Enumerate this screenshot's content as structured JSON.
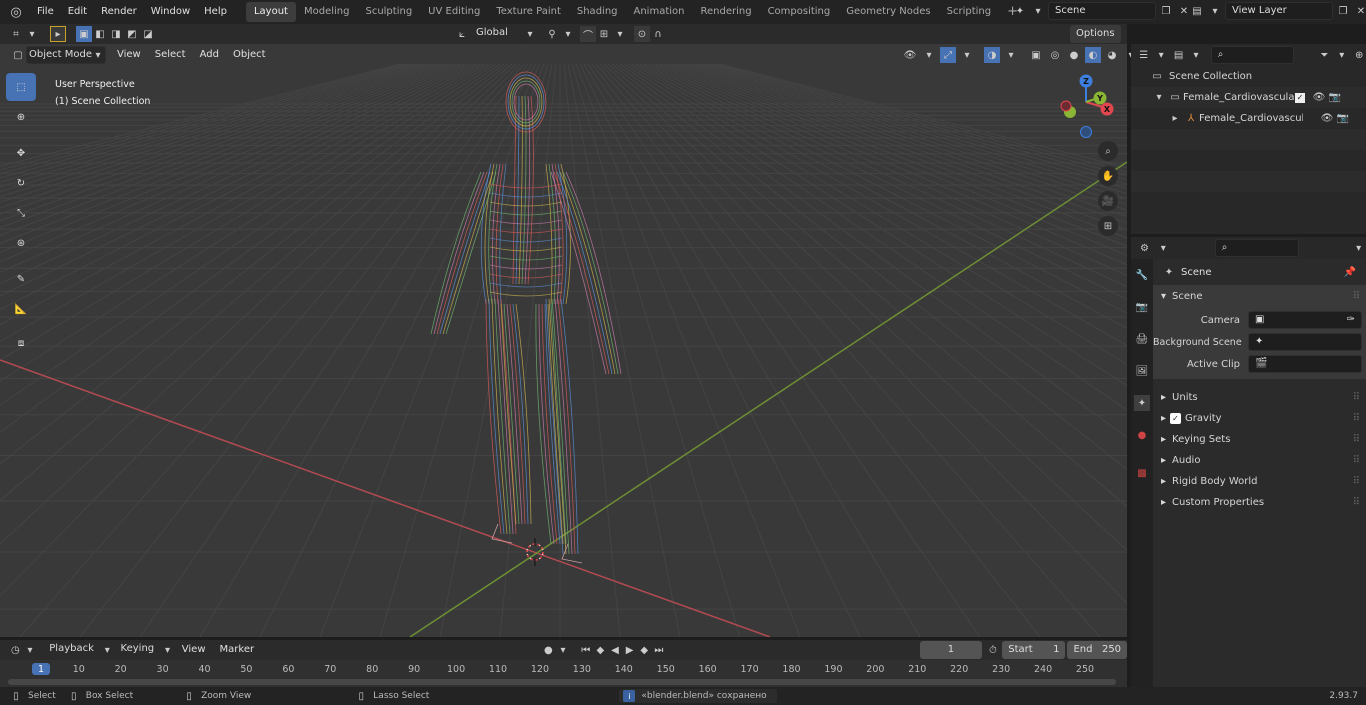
{
  "topbar": {
    "menus": [
      "File",
      "Edit",
      "Render",
      "Window",
      "Help"
    ],
    "workspaces": [
      "Layout",
      "Modeling",
      "Sculpting",
      "UV Editing",
      "Texture Paint",
      "Shading",
      "Animation",
      "Rendering",
      "Compositing",
      "Geometry Nodes",
      "Scripting"
    ],
    "active_workspace": "Layout",
    "add_tab": "+",
    "scene_name": "Scene",
    "view_layer": "View Layer"
  },
  "viewport_header": {
    "mode": "Object Mode",
    "menus": [
      "View",
      "Select",
      "Add",
      "Object"
    ],
    "orientation": "Global",
    "options": "Options"
  },
  "viewport": {
    "overlay_title": "User Perspective",
    "overlay_collection": "(1) Scene Collection",
    "gizmo_axes": {
      "x": "X",
      "y": "Y",
      "z": "Z"
    }
  },
  "outliner": {
    "root": "Scene Collection",
    "items": [
      {
        "label": "Female_Cardiovascular_Lymp"
      },
      {
        "label": "Female_Cardiovascular_l"
      }
    ]
  },
  "properties": {
    "context_title": "Scene",
    "panel_title": "Scene",
    "fields": [
      {
        "label": "Camera"
      },
      {
        "label": "Background Scene"
      },
      {
        "label": "Active Clip"
      }
    ],
    "sections": [
      "Units",
      "Gravity",
      "Keying Sets",
      "Audio",
      "Rigid Body World",
      "Custom Properties"
    ]
  },
  "timeline": {
    "menus": [
      "Playback",
      "Keying",
      "View",
      "Marker"
    ],
    "current_frame": "1",
    "start_label": "Start",
    "start": "1",
    "end_label": "End",
    "end": "250",
    "ruler": [
      "1",
      "10",
      "20",
      "30",
      "40",
      "50",
      "60",
      "70",
      "80",
      "90",
      "100",
      "110",
      "120",
      "130",
      "140",
      "150",
      "160",
      "170",
      "180",
      "190",
      "200",
      "210",
      "220",
      "230",
      "240",
      "250"
    ]
  },
  "status": {
    "select": "Select",
    "box_select": "Box Select",
    "zoom_view": "Zoom View",
    "lasso_select": "Lasso Select",
    "message": "«blender.blend» сохранено",
    "version": "2.93.7"
  },
  "colors": {
    "accent": "#4772b3",
    "x_axis": "#e0474f",
    "y_axis": "#8bb534",
    "z_axis": "#3d7fde"
  }
}
